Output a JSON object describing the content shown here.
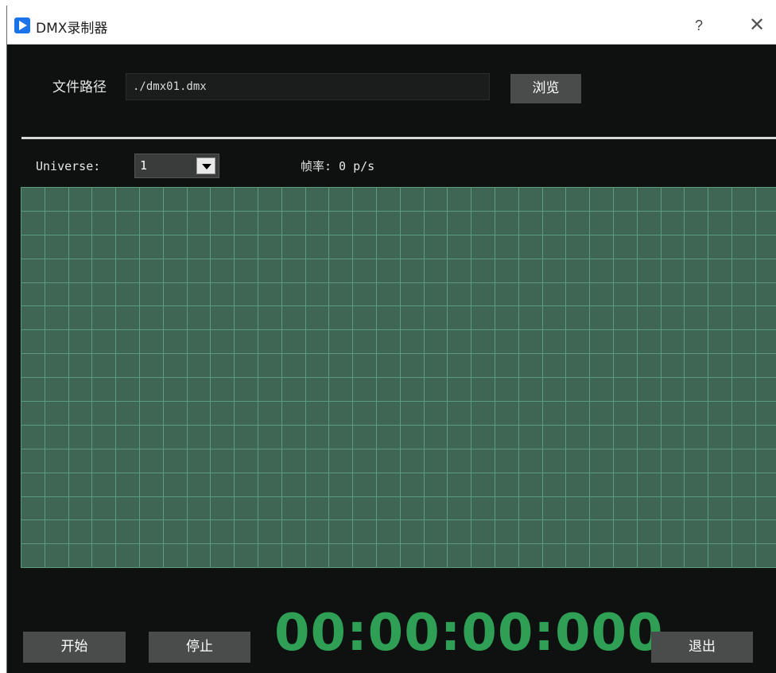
{
  "window": {
    "title": "DMX录制器",
    "help_label": "?",
    "close_label": "✕"
  },
  "file": {
    "label": "文件路径",
    "path_value": "./dmx01.dmx",
    "browse_label": "浏览"
  },
  "universe": {
    "label": "Universe:",
    "selected": "1"
  },
  "fps": {
    "text": "帧率: 0 p/s"
  },
  "grid": {
    "columns": 32,
    "rows": 16,
    "cell_color": "#3f6654",
    "line_color": "#5b9c7d"
  },
  "controls": {
    "start_label": "开始",
    "stop_label": "停止",
    "exit_label": "退出"
  },
  "timecode": "00:00:00:000",
  "colors": {
    "background": "#0f1111",
    "timecode": "#2e9f55",
    "button": "#4a4c4c",
    "app_icon": "#1a73e8"
  }
}
